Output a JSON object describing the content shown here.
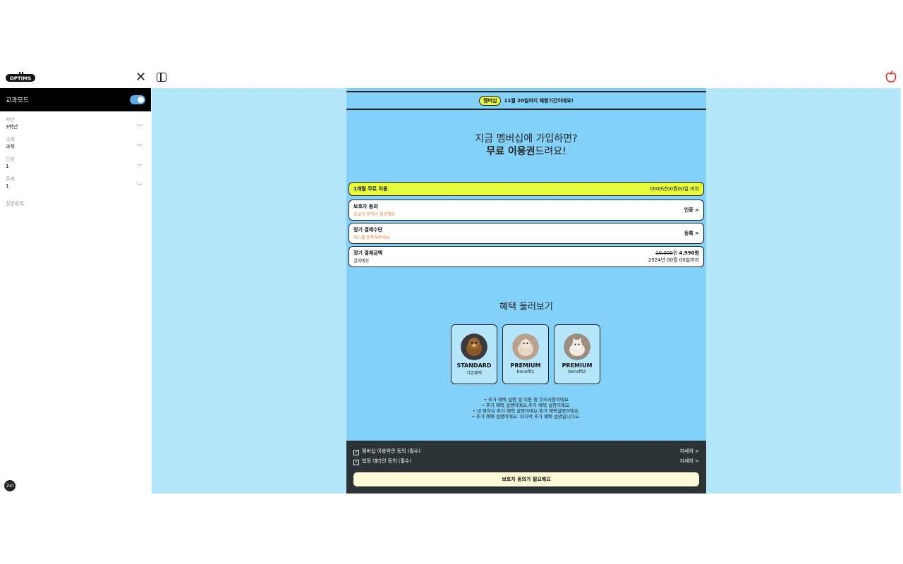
{
  "header": {
    "logo_text": "OPTIMS",
    "icons": {
      "close": "close-icon",
      "panel": "sidebar-toggle-icon",
      "apple": "apple-icon"
    }
  },
  "sidebar": {
    "mode_label": "교과모드",
    "mode_on": true,
    "fields": [
      {
        "label": "학년",
        "value": "3학년"
      },
      {
        "label": "과목",
        "value": "과학"
      },
      {
        "label": "단원",
        "value": "1"
      },
      {
        "label": "주제",
        "value": "1"
      }
    ],
    "register_label": "질문등록",
    "zoom_badge": "2xl"
  },
  "membership": {
    "badge": "멤버십",
    "banner_text": "11월 20일까지 체험기간이에요!",
    "hero_line1": "지금 멤버십에 가입하면?",
    "hero_line2_bold": "무료 이용권",
    "hero_line2_rest": "드려요!",
    "free_row": {
      "title": "1개월 무료 이용",
      "right": "0000년00월00일 까지"
    },
    "rows": [
      {
        "title": "보호자 동의",
        "sub": "보호자 동의가 필요해요",
        "action": "인증 >"
      },
      {
        "title": "정기 결제수단",
        "sub": "카드를 등록해주세요",
        "action": "등록 >"
      }
    ],
    "payment": {
      "title": "정기 결제금액",
      "sub": "결제예정",
      "original_price": "10,000",
      "price_unit": "원",
      "price": "4,990원",
      "until": "2024년 00월 00일까지"
    },
    "benefits_title": "혜택 둘러보기",
    "cards": [
      {
        "name": "STANDARD",
        "sub": "기본혜택"
      },
      {
        "name": "PREMIUM",
        "sub": "benefit1"
      },
      {
        "name": "PREMIUM",
        "sub": "benefit2"
      }
    ],
    "bullets": [
      "추가 혜택 설명 및 이용 중 주의사항이에요",
      "추가 혜택 설명이에요.추가 혜택 설명이에요.",
      "네 맞아요 추가 혜택 설명이에요.추가 혜택설명이에요.",
      "추가 혜택 설명이에요. 마지막 추가 혜택 설명입니다요."
    ],
    "agreements": [
      {
        "label": "멤버십 이용약관 동의 (필수)",
        "detail": "자세히 >"
      },
      {
        "label": "법정 대리인 동의 (필수)",
        "detail": "자세히 >"
      }
    ],
    "cta_label": "보호자 동의가 필요해요"
  },
  "colors": {
    "main_bg": "#b5e6fb",
    "panel_bg": "#83d1f9",
    "accent_yellow": "#e6fb3c",
    "footer_bg": "#2c3336",
    "warning_text": "#e77c2a",
    "toggle_on": "#5aa9e6"
  }
}
